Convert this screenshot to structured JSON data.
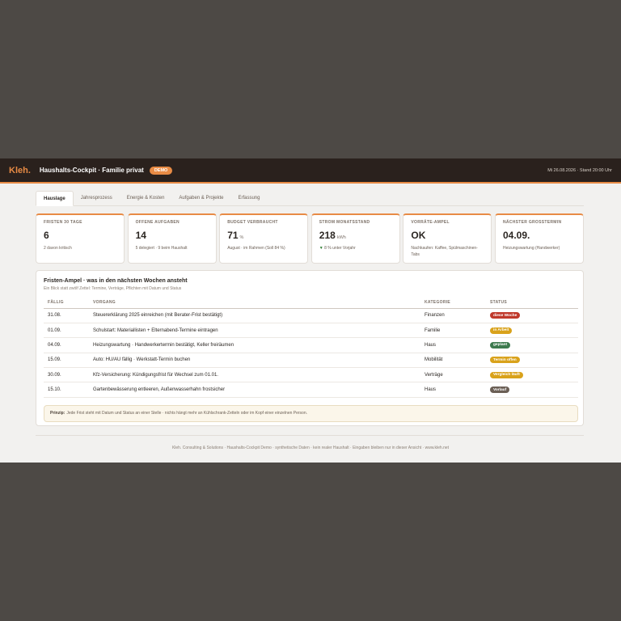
{
  "header": {
    "logo": "Kleh.",
    "title": "Haushalts-Cockpit · Familie privat",
    "badge": "DEMO",
    "datetime": "Mi 26.08.2026 · Stand 20:00 Uhr"
  },
  "tabs": [
    {
      "label": "Hauslage",
      "active": true
    },
    {
      "label": "Jahresprozess"
    },
    {
      "label": "Energie & Kosten"
    },
    {
      "label": "Aufgaben & Projekte"
    },
    {
      "label": "Erfassung"
    }
  ],
  "cards": [
    {
      "label": "FRISTEN 30 TAGE",
      "value": "6",
      "unit": "",
      "sub": "2 davon kritisch"
    },
    {
      "label": "OFFENE AUFGABEN",
      "value": "14",
      "unit": "",
      "sub": "5 delegiert · 9 beim Haushalt"
    },
    {
      "label": "BUDGET VERBRAUCHT",
      "value": "71",
      "unit": "%",
      "sub": "August · im Rahmen (Soll 84 %)"
    },
    {
      "label": "STROM MONATSSTAND",
      "value": "218",
      "unit": "kWh",
      "sub": "8 % unter Vorjahr"
    },
    {
      "label": "VORRÄTE-AMPEL",
      "value": "OK",
      "unit": "",
      "sub": "Nachkaufen: Kaffee, Spülmaschinen-Tabs"
    },
    {
      "label": "NÄCHSTER GROSSTERMIN",
      "value": "04.09.",
      "unit": "",
      "sub": "Heizungswartung (Handwerker)"
    }
  ],
  "panel": {
    "title": "Fristen-Ampel · was in den nächsten Wochen ansteht",
    "subtitle": "Ein Blick statt zwölf Zettel: Termine, Verträge, Pflichten mit Datum und Status",
    "columns": [
      "FÄLLIG",
      "VORGANG",
      "KATEGORIE",
      "STATUS"
    ],
    "rows": [
      {
        "due": "31.08.",
        "task": "Steuererklärung 2025 einreichen (mit Berater-Frist bestätigt)",
        "category": "Finanzen",
        "status": "diese Woche",
        "color": "#c0392b"
      },
      {
        "due": "01.09.",
        "task": "Schulstart: Materiallisten + Elternabend-Termine eintragen",
        "category": "Familie",
        "status": "in Arbeit",
        "color": "#d9a21b"
      },
      {
        "due": "04.09.",
        "task": "Heizungswartung · Handwerkertermin bestätigt, Keller freiräumen",
        "category": "Haus",
        "status": "geplant",
        "color": "#3d7a4e"
      },
      {
        "due": "15.09.",
        "task": "Auto: HU/AU fällig · Werkstatt-Termin buchen",
        "category": "Mobilität",
        "status": "Termin offen",
        "color": "#d9a21b"
      },
      {
        "due": "30.09.",
        "task": "Kfz-Versicherung: Kündigungsfrist für Wechsel zum 01.01.",
        "category": "Verträge",
        "status": "Vergleich läuft",
        "color": "#d9a21b"
      },
      {
        "due": "15.10.",
        "task": "Gartenbewässerung entleeren, Außenwasserhahn frostsicher",
        "category": "Haus",
        "status": "Vorlauf",
        "color": "#6b5f55"
      }
    ],
    "note_label": "Prinzip:",
    "note_text": "Jede Frist steht mit Datum und Status an einer Stelle · nichts hängt mehr an Kühlschrank-Zetteln oder im Kopf einer einzelnen Person."
  },
  "footer": "Kleh. Consulting & Solutions · Haushalts-Cockpit Demo · synthetische Daten · kein realer Haushalt · Eingaben bleiben nur in dieser Ansicht · www.kleh.net",
  "colors": {
    "accent": "#e88b45",
    "topbar": "#2a211d",
    "backdrop": "#4d4945"
  }
}
